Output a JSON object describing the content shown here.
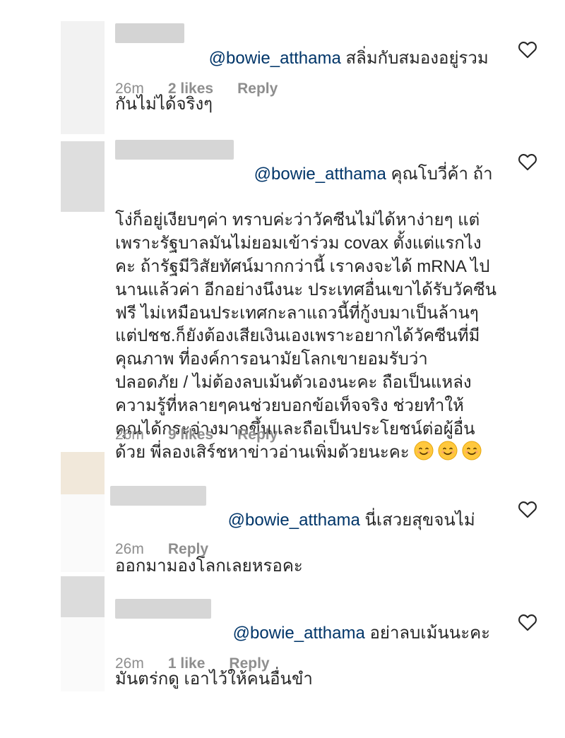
{
  "comments": [
    {
      "mention": "@bowie_atthama",
      "line1": " สลิ่มกับสมองอยู่รวม",
      "rest": "กันไม่ได้จริงๆ",
      "time": "26m",
      "likes": "2 likes",
      "reply": "Reply",
      "avatar_color": "#f0f0f0"
    },
    {
      "mention": "@bowie_atthama",
      "line1": " คุณโบวี่ค้า ถ้า",
      "rest": "โง่ก็อยู่เงียบๆค่า ทราบค่ะว่าวัคซีนไม่ได้หาง่ายๆ แต่\nเพราะรัฐบาลมันไม่ยอมเข้าร่วม covax ตั้งแต่แรกไง\nคะ ถ้ารัฐมีวิสัยทัศน์มากกว่านี้ เราคงจะได้ mRNA ไป\nนานแล้วค่า อีกอย่างนึงนะ ประเทศอื่นเขาได้รับวัคซีน\nฟรี ไม่เหมือนประเทศกะลาแถวนี้ที่กู้งบมาเป็นล้านๆ\nแต่ปชช.ก็ยังต้องเสียเงินเองเพราะอยากได้วัคซีนที่มี\nคุณภาพ ที่องค์การอนามัยโลกเขายอมรับว่า\nปลอดภัย / ไม่ต้องลบเม้นตัวเองนะคะ ถือเป็นแหล่ง\nความรู้ที่หลายๆคนช่วยบอกข้อเท็จจริง ช่วยทำให้\nคุณได้กระจ่างมากขึ้นและถือเป็นประโยชน์ต่อผู้อื่น\nด้วย พี่ลองเสิร์ชหาข่าวอ่านเพิ่มด้วยนะคะ",
      "time": "26m",
      "likes": "9 likes",
      "reply": "Reply",
      "avatar_color": "#dcdcdc"
    },
    {
      "mention": "@bowie_atthama",
      "line1": " นี่เสวยสุขจนไม่",
      "rest": "ออกมามองโลกเลยหรอคะ",
      "time": "26m",
      "likes": "",
      "reply": "Reply",
      "avatar_color": "#f1e8da"
    },
    {
      "mention": "@bowie_atthama",
      "line1": " อย่าลบเม้นนะคะ",
      "rest": "มันตร่กดู เอาไว้ให้คนอื่นขำ",
      "time": "26m",
      "likes": "1 like",
      "reply": "Reply",
      "avatar_color": "#dcdcdc"
    }
  ],
  "icons": {
    "heart": "heart-outline-icon",
    "emoji": "smiling-face-icon"
  },
  "colors": {
    "mention": "#003569",
    "meta": "#8e8e8e",
    "text": "#262626"
  }
}
